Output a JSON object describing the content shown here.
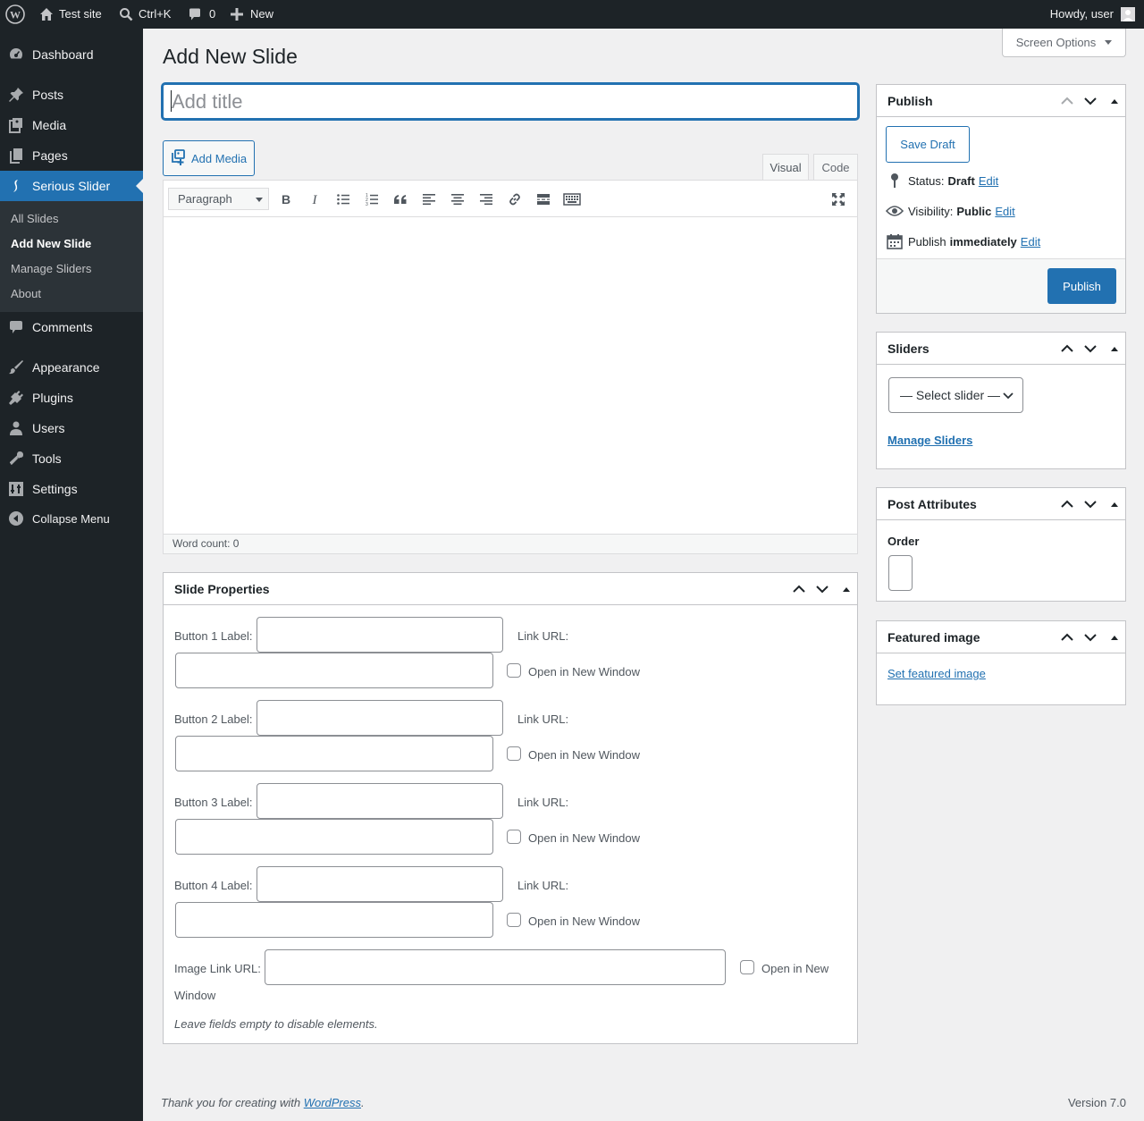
{
  "adminbar": {
    "site_name": "Test site",
    "search_shortcut": "Ctrl+K",
    "comments_count": "0",
    "new_label": "New",
    "greeting": "Howdy, user"
  },
  "sidebar": {
    "items": [
      {
        "label": "Dashboard",
        "icon": "dashboard-icon"
      },
      {
        "label": "Posts",
        "icon": "pin-icon"
      },
      {
        "label": "Media",
        "icon": "media-icon"
      },
      {
        "label": "Pages",
        "icon": "pages-icon"
      },
      {
        "label": "Serious Slider",
        "icon": "slider-icon"
      },
      {
        "label": "Comments",
        "icon": "comment-icon"
      },
      {
        "label": "Appearance",
        "icon": "brush-icon"
      },
      {
        "label": "Plugins",
        "icon": "plugin-icon"
      },
      {
        "label": "Users",
        "icon": "user-icon"
      },
      {
        "label": "Tools",
        "icon": "wrench-icon"
      },
      {
        "label": "Settings",
        "icon": "settings-icon"
      },
      {
        "label": "Collapse Menu",
        "icon": "collapse-icon"
      }
    ],
    "submenu": [
      "All Slides",
      "Add New Slide",
      "Manage Sliders",
      "About"
    ]
  },
  "main": {
    "screen_options": "Screen Options",
    "page_title": "Add New Slide",
    "title_placeholder": "Add title",
    "add_media": "Add Media",
    "tabs": {
      "visual": "Visual",
      "code": "Code"
    },
    "format_select": "Paragraph",
    "word_count": "Word count: 0"
  },
  "slide_properties": {
    "title": "Slide Properties",
    "buttons": [
      {
        "label": "Button 1 Label:",
        "link": "Link URL:",
        "new_window": "Open in New Window"
      },
      {
        "label": "Button 2 Label:",
        "link": "Link URL:",
        "new_window": "Open in New Window"
      },
      {
        "label": "Button 3 Label:",
        "link": "Link URL:",
        "new_window": "Open in New Window"
      },
      {
        "label": "Button 4 Label:",
        "link": "Link URL:",
        "new_window": "Open in New Window"
      }
    ],
    "image_link_label": "Image Link URL:",
    "image_new_window_a": "Open in New",
    "image_new_window_b": "Window",
    "note": "Leave fields empty to disable elements."
  },
  "publish": {
    "title": "Publish",
    "save_draft": "Save Draft",
    "status_label": "Status:",
    "status_value": "Draft",
    "visibility_label": "Visibility:",
    "visibility_value": "Public",
    "publish_label": "Publish",
    "publish_value": "immediately",
    "edit": "Edit",
    "publish_button": "Publish"
  },
  "sliders_box": {
    "title": "Sliders",
    "select_value": "— Select slider —",
    "manage_link": "Manage Sliders"
  },
  "attributes_box": {
    "title": "Post Attributes",
    "order_label": "Order"
  },
  "featured_box": {
    "title": "Featured image",
    "set_link": "Set featured image"
  },
  "footer": {
    "thanks_prefix": "Thank you for creating with ",
    "thanks_link": "WordPress",
    "thanks_suffix": ".",
    "version": "Version 7.0"
  },
  "colors": {
    "accent": "#2271b1",
    "adminbar_bg": "#1d2327",
    "submenu_bg": "#2c3338",
    "page_bg": "#f0f0f1"
  }
}
